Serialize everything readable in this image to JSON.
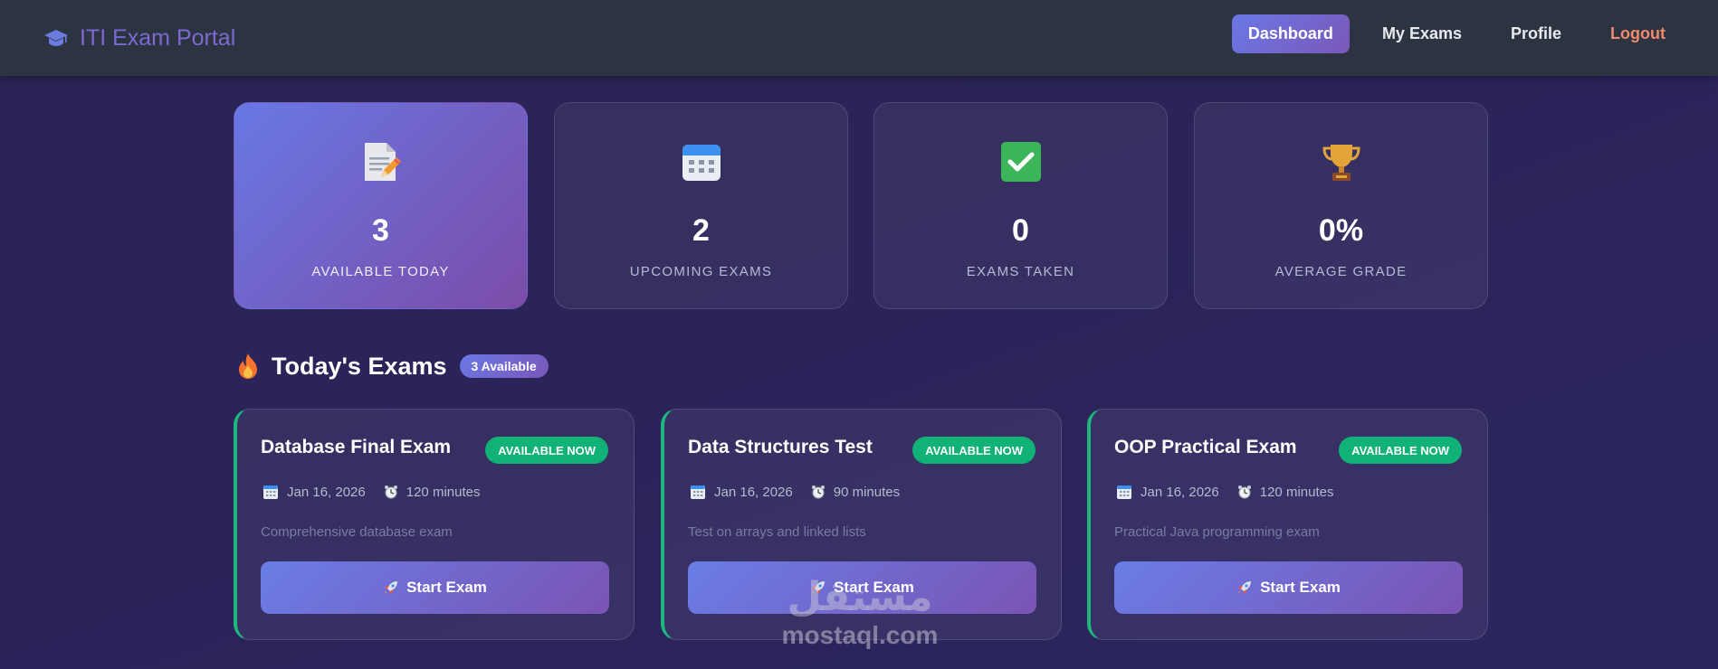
{
  "navbar": {
    "brand_title": "ITI Exam Portal",
    "brand_icon": "graduation-cap-icon",
    "links": [
      {
        "label": "Dashboard",
        "active": true
      },
      {
        "label": "My Exams",
        "active": false
      },
      {
        "label": "Profile",
        "active": false
      },
      {
        "label": "Logout",
        "active": false
      }
    ]
  },
  "stats": [
    {
      "icon": "memo-icon",
      "value": "3",
      "label": "AVAILABLE TODAY"
    },
    {
      "icon": "calendar-icon",
      "value": "2",
      "label": "UPCOMING EXAMS"
    },
    {
      "icon": "check-mark-icon",
      "value": "0",
      "label": "EXAMS TAKEN"
    },
    {
      "icon": "trophy-icon",
      "value": "0%",
      "label": "AVERAGE GRADE"
    }
  ],
  "section": {
    "icon": "fire-icon",
    "title": "Today's Exams",
    "badge": "3 Available"
  },
  "exams": [
    {
      "title": "Database Final Exam",
      "status": "AVAILABLE NOW",
      "date": "Jan 16, 2026",
      "duration": "120 minutes",
      "description": "Comprehensive database exam",
      "button": "Start Exam"
    },
    {
      "title": "Data Structures Test",
      "status": "AVAILABLE NOW",
      "date": "Jan 16, 2026",
      "duration": "90 minutes",
      "description": "Test on arrays and linked lists",
      "button": "Start Exam"
    },
    {
      "title": "OOP Practical Exam",
      "status": "AVAILABLE NOW",
      "date": "Jan 16, 2026",
      "duration": "120 minutes",
      "description": "Practical Java programming exam",
      "button": "Start Exam"
    }
  ],
  "watermark": {
    "logo": "مستقل",
    "site": "mostaql.com"
  },
  "colors": {
    "accent_start": "#6a78e6",
    "accent_end": "#7b57b8",
    "available_green": "#10b277",
    "logout": "#f08a6e",
    "navbar": "#2c3441"
  }
}
